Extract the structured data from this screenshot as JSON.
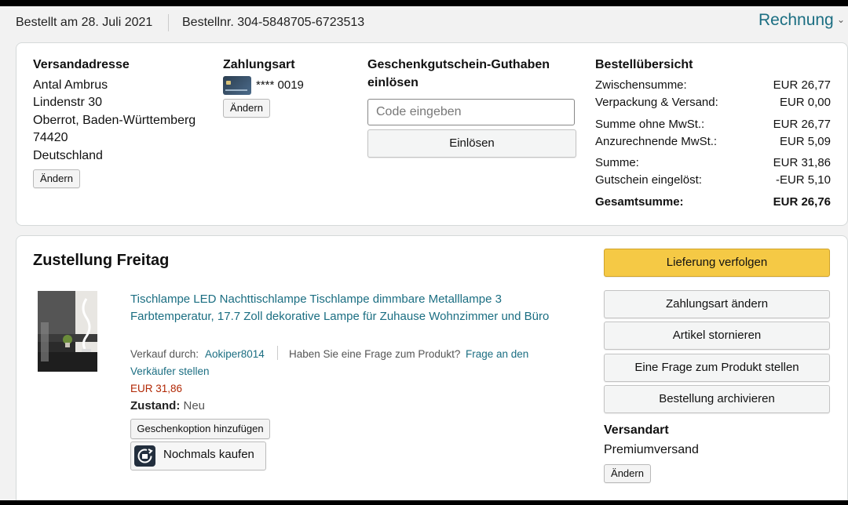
{
  "header": {
    "order_date": "Bestellt am 28. Juli 2021",
    "order_number": "Bestellnr. 304-5848705-6723513",
    "invoice_label": "Rechnung",
    "chevron": "chevron-down-icon"
  },
  "shipping_address": {
    "title": "Versandadresse",
    "lines": [
      "Antal Ambrus",
      "Lindenstr 30",
      "Oberrot, Baden-Württemberg",
      "74420",
      "Deutschland"
    ],
    "change_label": "Ändern"
  },
  "payment": {
    "title": "Zahlungsart",
    "card_icon": "credit-card-icon",
    "card_number": "**** 0019",
    "change_label": "Ändern"
  },
  "gift_card": {
    "title_line1": "Geschenkgutschein-Guthaben",
    "title_line2": "einlösen",
    "placeholder": "Code eingeben",
    "redeem_label": "Einlösen"
  },
  "summary": {
    "title": "Bestellübersicht",
    "rows": [
      {
        "label": "Zwischensumme:",
        "value": "EUR 26,77"
      },
      {
        "label": "Verpackung & Versand:",
        "value": "EUR 0,00"
      },
      {
        "label": "Summe ohne MwSt.:",
        "value": "EUR 26,77"
      },
      {
        "label": "Anzurechnende MwSt.:",
        "value": "EUR 5,09"
      },
      {
        "label": "Summe:",
        "value": "EUR 31,86"
      },
      {
        "label": "Gutschein eingelöst:",
        "value": "-EUR 5,10"
      },
      {
        "label": "Gesamtsumme:",
        "value": "EUR 26,76"
      }
    ]
  },
  "delivery": {
    "title": "Zustellung Freitag",
    "product": {
      "title": "Tischlampe LED Nachttischlampe Tischlampe dimmbare Metalllampe 3 Farbtemperatur, 17.7 Zoll dekorative Lampe für Zuhause Wohnzimmer und Büro",
      "sold_by_label": "Verkauf durch:",
      "seller": "Aokiper8014",
      "question_text": "Haben Sie eine Frage zum Produkt?",
      "question_link_1": "Frage an den",
      "question_link_2": "Verkäufer stellen",
      "price": "EUR 31,86",
      "condition_label": "Zustand:",
      "condition_value": "Neu",
      "gift_option_label": "Geschenkoption hinzufügen",
      "rebuy_label": "Nochmals kaufen",
      "rebuy_icon": "rebuy-icon"
    },
    "actions": {
      "track": "Lieferung verfolgen",
      "change_payment": "Zahlungsart ändern",
      "cancel": "Artikel stornieren",
      "ask_question": "Eine Frage zum Produkt stellen",
      "archive": "Bestellung archivieren"
    },
    "shipping_method": {
      "title": "Versandart",
      "value": "Premiumversand",
      "change_label": "Ändern"
    }
  },
  "colors": {
    "link": "#1b6e82",
    "price": "#b12704",
    "primary_button": "#f5c945"
  }
}
